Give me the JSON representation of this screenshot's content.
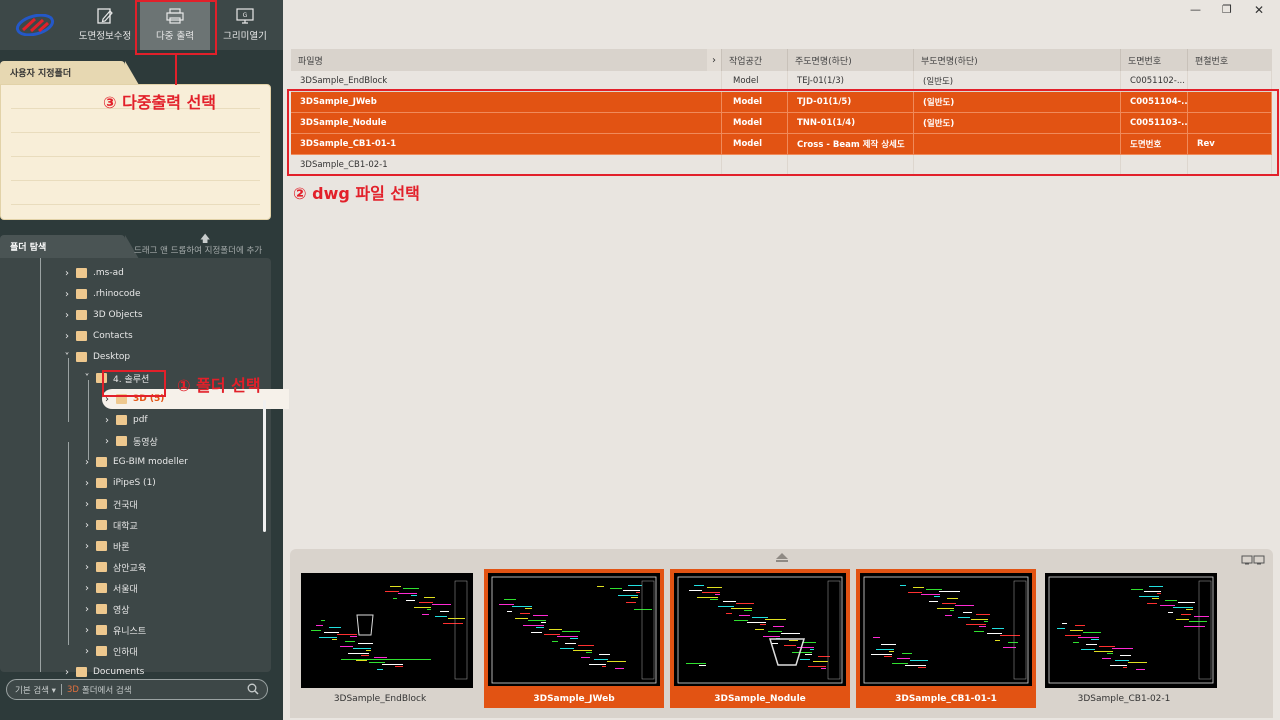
{
  "toolbar": {
    "buttons": [
      {
        "label": "도면정보수정",
        "icon": "edit-icon"
      },
      {
        "label": "다중 출력",
        "icon": "printer-icon"
      },
      {
        "label": "그리미열기",
        "icon": "monitor-icon"
      }
    ]
  },
  "favorites": {
    "tab_label": "사용자 지정폴더"
  },
  "navigator": {
    "tab_label": "폴더 탐색",
    "hint": "드래그 앤 드롭하여 지정폴더에 추가"
  },
  "tree": [
    {
      "label": ".ms-ad",
      "level": 2
    },
    {
      "label": ".rhinocode",
      "level": 2
    },
    {
      "label": "3D Objects",
      "level": 2
    },
    {
      "label": "Contacts",
      "level": 2
    },
    {
      "label": "Desktop",
      "level": 2,
      "expanded": true
    },
    {
      "label": "4. 솔루션",
      "level": 3,
      "expanded": true
    },
    {
      "label": "3D (5)",
      "level": 4,
      "selected": true
    },
    {
      "label": "pdf",
      "level": 4
    },
    {
      "label": "동영상",
      "level": 4
    },
    {
      "label": "EG-BIM modeller",
      "level": 3
    },
    {
      "label": "iPipeS (1)",
      "level": 3
    },
    {
      "label": "건국대",
      "level": 3
    },
    {
      "label": "대학교",
      "level": 3
    },
    {
      "label": "바론",
      "level": 3
    },
    {
      "label": "삼안교육",
      "level": 3
    },
    {
      "label": "서울대",
      "level": 3
    },
    {
      "label": "영상",
      "level": 3
    },
    {
      "label": "유니스트",
      "level": 3
    },
    {
      "label": "인하대",
      "level": 3
    },
    {
      "label": "Documents",
      "level": 2
    }
  ],
  "search": {
    "mode": "기본 검색 ▾",
    "scope": "3D",
    "placeholder": "폴더에서 검색"
  },
  "table": {
    "columns": [
      "파일명",
      "작업공간",
      "주도면명(하단)",
      "부도면명(하단)",
      "도면번호",
      "편철번호"
    ],
    "rows": [
      {
        "cells": [
          "3DSample_EndBlock",
          "Model",
          "TEJ-01(1/3)",
          "(일반도)",
          "C0051102-...",
          ""
        ],
        "selected": false
      },
      {
        "cells": [
          "3DSample_JWeb",
          "Model",
          "TJD-01(1/5)",
          "(일반도)",
          "C0051104-...",
          ""
        ],
        "selected": true
      },
      {
        "cells": [
          "3DSample_Nodule",
          "Model",
          "TNN-01(1/4)",
          "(일반도)",
          "C0051103-...",
          ""
        ],
        "selected": true
      },
      {
        "cells": [
          "3DSample_CB1-01-1",
          "Model",
          "Cross - Beam 제작 상세도",
          "",
          "도면번호",
          "Rev"
        ],
        "selected": true
      },
      {
        "cells": [
          "3DSample_CB1-02-1",
          "",
          "",
          "",
          "",
          ""
        ],
        "selected": false
      }
    ]
  },
  "thumbnails": [
    {
      "caption": "3DSample_EndBlock",
      "selected": false
    },
    {
      "caption": "3DSample_JWeb",
      "selected": true
    },
    {
      "caption": "3DSample_Nodule",
      "selected": true
    },
    {
      "caption": "3DSample_CB1-01-1",
      "selected": true
    },
    {
      "caption": "3DSample_CB1-02-1",
      "selected": false
    }
  ],
  "annotations": {
    "step1": "① 폴더 선택",
    "step2": "② dwg 파일 선택",
    "step3": "③ 다중출력 선택"
  },
  "colors": {
    "accent": "#e25313",
    "annotation": "#e2202a"
  }
}
